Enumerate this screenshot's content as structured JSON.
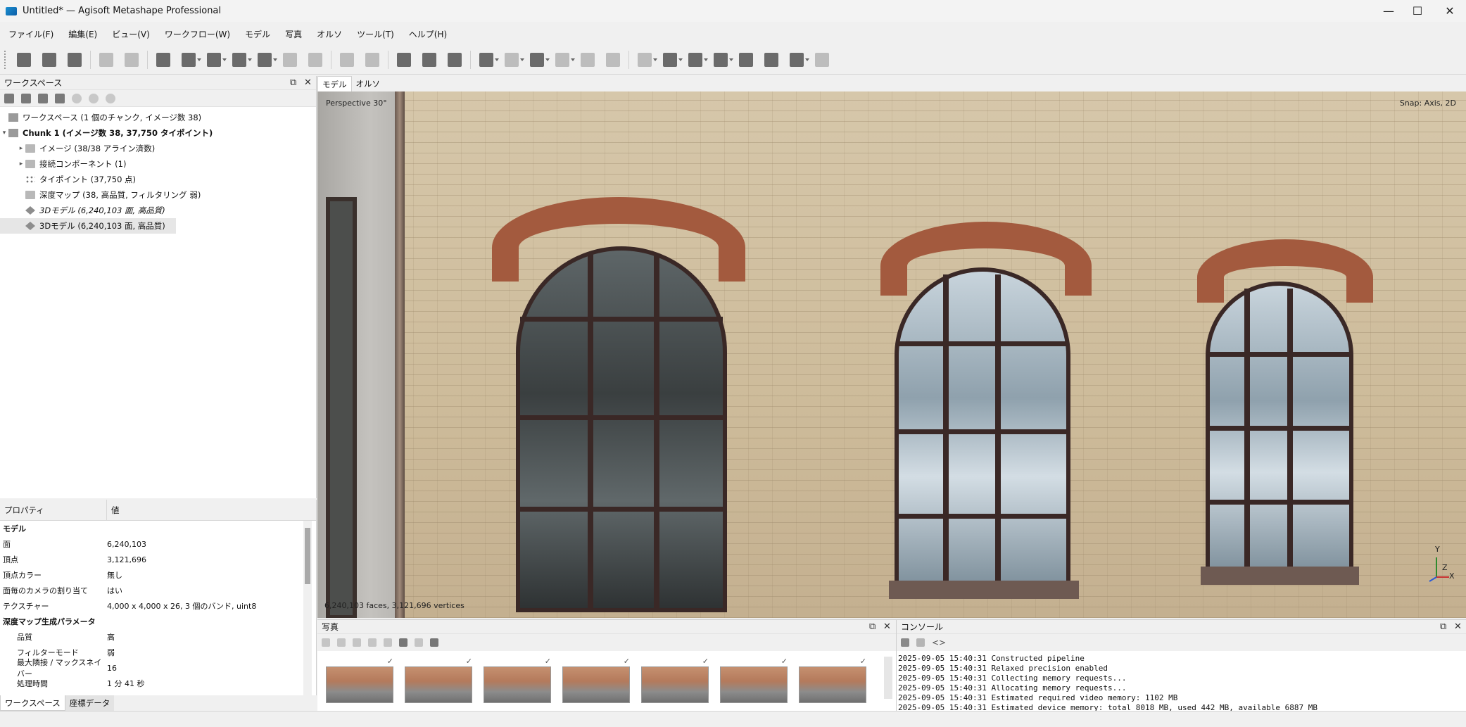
{
  "window": {
    "title": "Untitled* — Agisoft Metashape Professional",
    "minimize": "—",
    "maximize": "☐",
    "close": "✕"
  },
  "menu": [
    "ファイル(F)",
    "編集(E)",
    "ビュー(V)",
    "ワークフロー(W)",
    "モデル",
    "写真",
    "オルソ",
    "ツール(T)",
    "ヘルプ(H)"
  ],
  "workspace": {
    "title": "ワークスペース",
    "tree": [
      {
        "label": "ワークスペース (1 個のチャンク, イメージ数 38)"
      },
      {
        "label": "Chunk 1 (イメージ数 38, 37,750 タイポイント)"
      },
      {
        "label": "イメージ (38/38 アライン済数)"
      },
      {
        "label": "接続コンポーネント (1)"
      },
      {
        "label": "タイポイント (37,750 点)"
      },
      {
        "label": "深度マップ (38, 高品質, フィルタリング 弱)"
      },
      {
        "label": "3Dモデル (6,240,103 面, 高品質)"
      },
      {
        "label": "3Dモデル (6,240,103 面, 高品質)"
      }
    ]
  },
  "properties": {
    "col_property": "プロパティ",
    "col_value": "値",
    "rows": [
      {
        "k": "モデル",
        "v": ""
      },
      {
        "k": "面",
        "v": "6,240,103"
      },
      {
        "k": "頂点",
        "v": "3,121,696"
      },
      {
        "k": "頂点カラー",
        "v": "無し"
      },
      {
        "k": "面毎のカメラの割り当て",
        "v": "はい"
      },
      {
        "k": "テクスチャー",
        "v": "4,000 x 4,000 x 26, 3 個のバンド, uint8"
      },
      {
        "k": "深度マップ生成パラメータ",
        "v": ""
      },
      {
        "k": "品質",
        "v": "高"
      },
      {
        "k": "フィルターモード",
        "v": "弱"
      },
      {
        "k": "最大隣接 / マックスネイバー",
        "v": "16"
      },
      {
        "k": "処理時間",
        "v": "1 分 41 秒"
      }
    ]
  },
  "bottom_tabs": [
    "ワークスペース",
    "座標データ"
  ],
  "view": {
    "tabs": [
      "モデル",
      "オルソ"
    ],
    "perspective": "Perspective 30°",
    "snap": "Snap: Axis, 2D",
    "stats": "6,240,103 faces, 3,121,696 vertices",
    "axis_y": "Y",
    "axis_z": "Z",
    "axis_x": "X"
  },
  "photos": {
    "title": "写真",
    "check": "✓",
    "count": 7
  },
  "console": {
    "title": "コンソール",
    "code_icon": "<>",
    "lines": [
      "2025-09-05 15:40:31 Constructed pipeline",
      "2025-09-05 15:40:31 Relaxed precision enabled",
      "2025-09-05 15:40:31 Collecting memory requests...",
      "2025-09-05 15:40:31 Allocating memory requests...",
      "2025-09-05 15:40:31 Estimated required video memory: 1102 MB",
      "2025-09-05 15:40:31 Estimated device memory: total 8018 MB, used 442 MB, available 6887 MB"
    ]
  },
  "panel_buttons": {
    "float": "⧉",
    "close": "✕"
  }
}
